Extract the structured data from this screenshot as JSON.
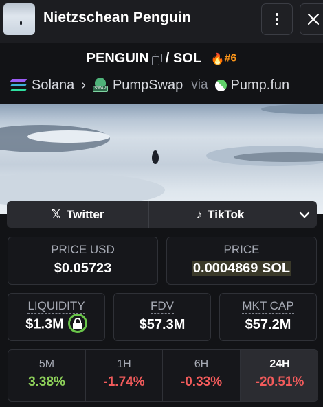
{
  "header": {
    "title": "Nietzschean Penguin",
    "more_icon": "more-vertical-icon",
    "close_icon": "close-icon"
  },
  "pair": {
    "base": "PENGUIN",
    "separator": "/",
    "quote": "SOL",
    "rank": "#6",
    "copy_icon": "copy-icon",
    "trending_icon": "flame-icon"
  },
  "route": {
    "chain": "Solana",
    "dex": "PumpSwap",
    "dex_logo_text": "SWAP",
    "via_label": "via",
    "launchpad": "Pump.fun"
  },
  "socials": {
    "twitter_label": "Twitter",
    "tiktok_label": "TikTok"
  },
  "stats": {
    "price_usd_label": "PRICE USD",
    "price_usd_value": "$0.05723",
    "price_label": "PRICE",
    "price_value": "0.0004869 SOL",
    "liquidity_label": "LIQUIDITY",
    "liquidity_value": "$1.3M",
    "fdv_label": "FDV",
    "fdv_value": "$57.3M",
    "mktcap_label": "MKT CAP",
    "mktcap_value": "$57.2M"
  },
  "timeframes": [
    {
      "label": "5M",
      "value": "3.38%",
      "direction": "up"
    },
    {
      "label": "1H",
      "value": "-1.74%",
      "direction": "down"
    },
    {
      "label": "6H",
      "value": "-0.33%",
      "direction": "down"
    },
    {
      "label": "24H",
      "value": "-20.51%",
      "direction": "down",
      "active": true
    }
  ],
  "colors": {
    "positive": "#8ed15a",
    "negative": "#f15b5b",
    "trending": "#f7931a",
    "lock_ring": "#6ac64a"
  }
}
